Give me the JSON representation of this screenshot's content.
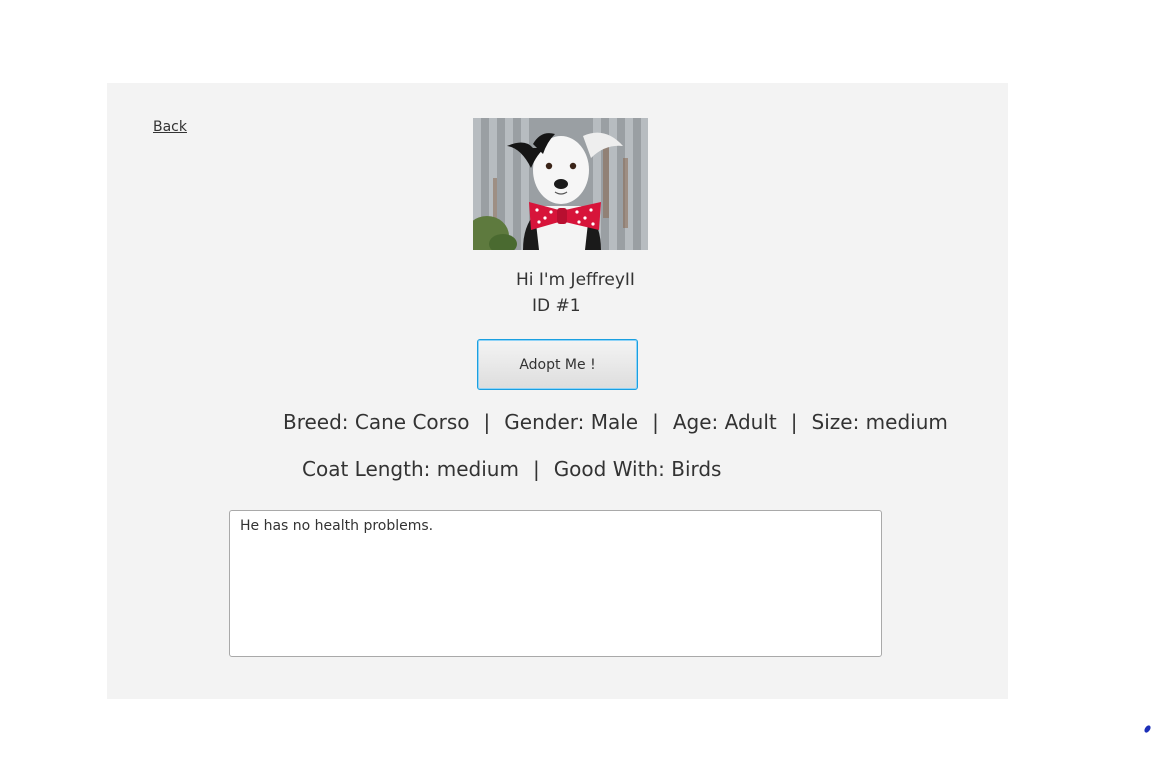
{
  "nav": {
    "back_label": "Back"
  },
  "pet": {
    "photo_alt": "pet-photo",
    "greeting": "Hi I'm JeffreyII",
    "id_text": "ID #1"
  },
  "actions": {
    "adopt_label": "Adopt Me !"
  },
  "attributes": {
    "breed": "Breed: Cane Corso",
    "gender": "Gender: Male",
    "age": "Age: Adult",
    "size": "Size: medium",
    "coat_length": "Coat Length: medium",
    "good_with": "Good With: Birds",
    "separator": "|"
  },
  "notes": {
    "value": "He has no health problems."
  },
  "colors": {
    "panel_bg": "#f3f3f3",
    "button_focus": "#1a9fe0",
    "bowtie": "#d7143a"
  }
}
